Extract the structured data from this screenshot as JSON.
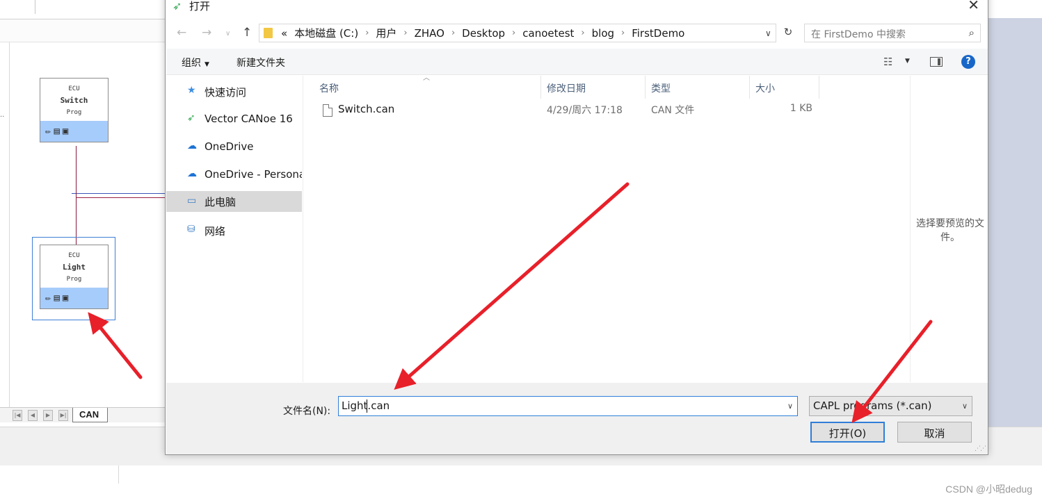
{
  "background": {
    "ecu_switch": {
      "type": "ECU",
      "name": "Switch",
      "sub": "Prog"
    },
    "ecu_light": {
      "type": "ECU",
      "name": "Light",
      "sub": "Prog"
    },
    "tab_label": "CAN",
    "watermark": "CSDN @小昭dedug"
  },
  "dialog": {
    "title": "打开",
    "address": {
      "overflow": "«",
      "segments": [
        "本地磁盘 (C:)",
        "用户",
        "ZHAO",
        "Desktop",
        "canoetest",
        "blog",
        "FirstDemo"
      ]
    },
    "search_placeholder": "在 FirstDemo 中搜索",
    "toolbar": {
      "organize": "组织",
      "new_folder": "新建文件夹"
    },
    "nav": [
      {
        "label": "快速访问",
        "icon": "star-icon"
      },
      {
        "label": "Vector CANoe 16",
        "icon": "canoe-icon"
      },
      {
        "label": "OneDrive",
        "icon": "cloud-icon"
      },
      {
        "label": "OneDrive - Persona",
        "icon": "cloud-icon"
      },
      {
        "label": "此电脑",
        "icon": "computer-icon",
        "selected": true
      },
      {
        "label": "网络",
        "icon": "network-icon"
      }
    ],
    "columns": {
      "name": "名称",
      "date": "修改日期",
      "type": "类型",
      "size": "大小"
    },
    "files": [
      {
        "name": "Switch.can",
        "date": "4/29/周六 17:18",
        "type": "CAN 文件",
        "size": "1 KB"
      }
    ],
    "preview_text": "选择要预览的文件。",
    "filename_label": "文件名(N):",
    "filename_value": "Light.can",
    "filetype_value": "CAPL programs (*.can)",
    "open_button": "打开(O)",
    "cancel_button": "取消"
  },
  "colors": {
    "accent": "#2f7ed8",
    "arrow": "#e8202a",
    "ecu_bar": "#a6ccfb"
  }
}
